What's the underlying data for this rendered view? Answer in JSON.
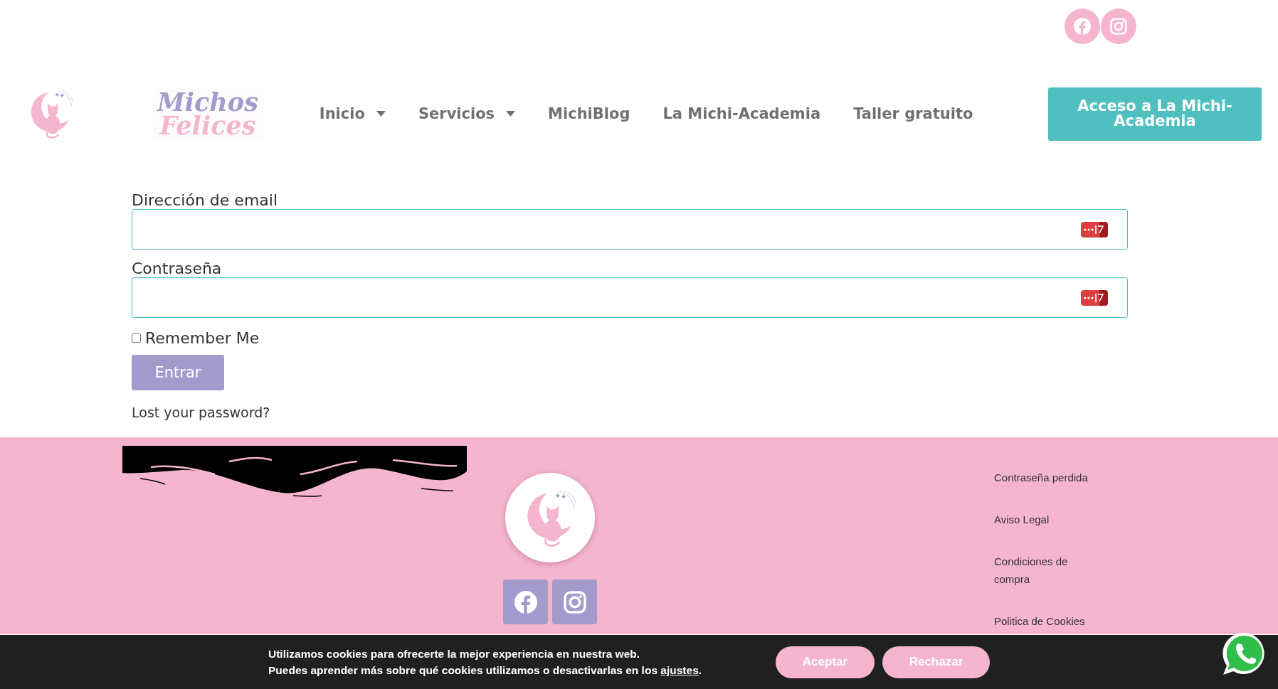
{
  "header": {
    "social_links": [
      {
        "kind": "facebook"
      },
      {
        "kind": "instagram"
      }
    ],
    "logo": {
      "line_1": "Michos",
      "line_2": "Felices"
    },
    "nav": [
      {
        "label": "Inicio",
        "has_dropdown": true
      },
      {
        "label": "Servicios",
        "has_dropdown": true
      },
      {
        "label": "MichiBlog",
        "has_dropdown": false
      },
      {
        "label": "La Michi-Academia",
        "has_dropdown": false
      },
      {
        "label": "Taller gratuito",
        "has_dropdown": false
      }
    ],
    "cta_button": "Acceso a La Michi-Academia"
  },
  "login_form": {
    "fields": [
      {
        "label": "Dirección de email"
      },
      {
        "label": "Contraseña"
      }
    ],
    "remember_me": {
      "label": "Remember Me",
      "checked": false
    },
    "submit_button": "Entrar",
    "lost_password_link": "Lost your password?"
  },
  "footer": {
    "social_links": [
      {
        "kind": "facebook"
      },
      {
        "kind": "instagram"
      }
    ],
    "links": [
      "Contraseña perdida",
      "Aviso Legal",
      "Condiciones de compra",
      "Politica de Cookies"
    ]
  },
  "cookie_bar": {
    "line_1": "Utilizamos cookies para ofrecerte la mejor experiencia en nuestra web.",
    "line_2": "Puedes aprender más sobre qué cookies utilizamos o desactivarlas en los",
    "link": "ajustes",
    "line_2_end": ".",
    "buttons": [
      "Aceptar",
      "Rechazar"
    ]
  }
}
